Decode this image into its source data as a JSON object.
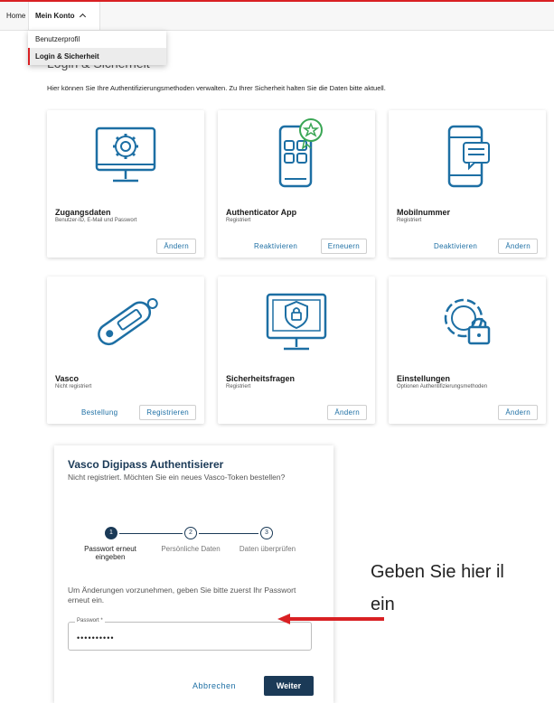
{
  "nav": {
    "home": "Home",
    "account": "Mein Konto",
    "dropdown": [
      "Benutzerprofil",
      "Login & Sicherheit"
    ]
  },
  "page": {
    "title": "Login & Sicherheit",
    "intro": "Hier können Sie Ihre Authentifizierungsmethoden verwalten. Zu Ihrer Sicherheit halten Sie die Daten bitte aktuell."
  },
  "cards": [
    {
      "icon": "monitor-gear-icon",
      "title": "Zugangsdaten",
      "subtitle": "Benutzer-ID, E-Mail und Passwort",
      "buttons": [
        "Ändern"
      ]
    },
    {
      "icon": "phone-app-badge-icon",
      "title": "Authenticator App",
      "subtitle": "Registriert",
      "buttons": [
        "Reaktivieren",
        "Erneuern"
      ]
    },
    {
      "icon": "phone-chat-icon",
      "title": "Mobilnummer",
      "subtitle": "Registriert",
      "buttons": [
        "Deaktivieren",
        "Ändern"
      ]
    },
    {
      "icon": "token-device-icon",
      "title": "Vasco",
      "subtitle": "Nicht registriert",
      "buttons": [
        "Bestellung",
        "Registrieren"
      ]
    },
    {
      "icon": "monitor-shield-icon",
      "title": "Sicherheitsfragen",
      "subtitle": "Registriert",
      "buttons": [
        "Ändern"
      ]
    },
    {
      "icon": "gear-lock-icon",
      "title": "Einstellungen",
      "subtitle": "Optionen Authentifizierungsmethoden",
      "buttons": [
        "Ändern"
      ]
    }
  ],
  "modal": {
    "title": "Vasco Digipass Authentisierer",
    "subtitle": "Nicht registriert. Möchten Sie ein neues Vasco-Token bestellen?",
    "steps": [
      {
        "number": "1",
        "label": "Passwort erneut eingeben"
      },
      {
        "number": "2",
        "label": "Persönliche Daten"
      },
      {
        "number": "3",
        "label": "Daten überprüfen"
      }
    ],
    "text": "Um Änderungen vorzunehmen, geben Sie bitte zuerst Ihr Passwort erneut ein.",
    "password_label": "Passwort *",
    "password_value": "••••••••••",
    "cancel": "Abbrechen",
    "next": "Weiter"
  },
  "annotation": {
    "line1": "Geben Sie hier il",
    "line2": "ein"
  },
  "colors": {
    "accent": "#d92023",
    "brand": "#1d6fa4",
    "dark": "#1b3a57"
  }
}
